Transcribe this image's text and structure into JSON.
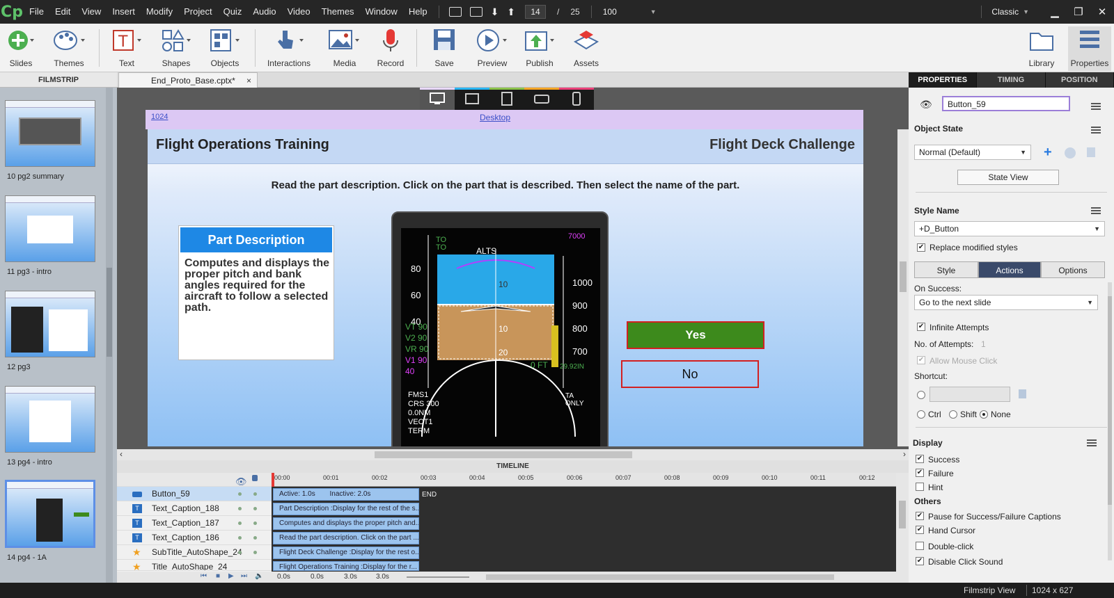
{
  "menubar": {
    "logo": "Cp",
    "menus": [
      "File",
      "Edit",
      "View",
      "Insert",
      "Modify",
      "Project",
      "Quiz",
      "Audio",
      "Video",
      "Themes",
      "Window",
      "Help"
    ],
    "slide_current": "14",
    "slide_separator": "/",
    "slide_total": "25",
    "zoom": "100",
    "workspace": "Classic"
  },
  "toolbar": {
    "items": [
      "Slides",
      "Themes",
      "Text",
      "Shapes",
      "Objects",
      "Interactions",
      "Media",
      "Record",
      "Save",
      "Preview",
      "Publish",
      "Assets",
      "Library",
      "Properties"
    ]
  },
  "filmstrip": {
    "header": "FILMSTRIP",
    "items": [
      "10 pg2 summary",
      "11 pg3 - intro",
      "12 pg3",
      "13 pg4 - intro",
      "14 pg4 - 1A"
    ]
  },
  "document": {
    "tab_name": "End_Proto_Base.cptx*",
    "close": "×"
  },
  "stage": {
    "ruler_left": "1024",
    "ruler_center": "Desktop",
    "device_colors": [
      "#ffffff",
      "#29b6f6",
      "#8bc34a",
      "#ffa726",
      "#ec407a"
    ]
  },
  "slide": {
    "title": "Flight Operations Training",
    "subtitle": "Flight Deck Challenge",
    "instruction": "Read the part description. Click on the part that is described. Then select the name of the part.",
    "part_heading": "Part Description",
    "part_body": "Computes and displays the proper pitch and bank angles required for the aircraft to follow a selected path.",
    "yes": "Yes",
    "no": "No",
    "pfd": {
      "alts": "ALTS",
      "speeds": [
        "80",
        "60",
        "40"
      ],
      "vspeeds": [
        "VT 90",
        "V2 90",
        "VR 90",
        "V1 90",
        "40"
      ],
      "alt_values": [
        "1000",
        "900",
        "800",
        "700"
      ],
      "alt_top": "7000",
      "zero_ft": "0 FT",
      "baro": "29.92IN",
      "fms": [
        "FMS1",
        "CRS 300",
        "0.0NM",
        "VECT1",
        "TERM"
      ],
      "pitch": [
        "10",
        "10",
        "20"
      ],
      "to": [
        "TO",
        "TO"
      ],
      "ta_only": [
        "TA",
        "ONLY"
      ]
    }
  },
  "timeline": {
    "header": "TIMELINE",
    "ticks": [
      "00:00",
      "00:01",
      "00:02",
      "00:03",
      "00:04",
      "00:05",
      "00:06",
      "00:07",
      "00:08",
      "00:09",
      "00:10",
      "00:11",
      "00:12"
    ],
    "rows": [
      {
        "name": "Button_59",
        "bar_a": "Active: 1.0s",
        "bar_b": "Inactive: 2.0s"
      },
      {
        "name": "Text_Caption_188",
        "bar": "Part Description :Display for the rest of the s..."
      },
      {
        "name": "Text_Caption_187",
        "bar": "Computes and displays the proper pitch and..."
      },
      {
        "name": "Text_Caption_186",
        "bar": "Read the part description. Click on the part ..."
      },
      {
        "name": "SubTitle_AutoShape_24",
        "bar": "Flight Deck Challenge :Display for the rest o..."
      },
      {
        "name": "Title_AutoShape_24",
        "bar": "Flight Operations Training :Display for the r..."
      }
    ],
    "end_label": "END",
    "bottom": [
      "0.0s",
      "0.0s",
      "3.0s",
      "3.0s"
    ]
  },
  "properties": {
    "tabs": [
      "PROPERTIES",
      "TIMING",
      "POSITION"
    ],
    "object_name": "Button_59",
    "object_state_label": "Object State",
    "state_value": "Normal (Default)",
    "state_view": "State View",
    "style_name_label": "Style Name",
    "style_value": "+D_Button",
    "replace_styles": "Replace modified styles",
    "segments": [
      "Style",
      "Actions",
      "Options"
    ],
    "on_success_label": "On Success:",
    "on_success_value": "Go to the next slide",
    "infinite": "Infinite Attempts",
    "attempts_label": "No. of Attempts:",
    "attempts_value": "1",
    "allow_mouse": "Allow Mouse Click",
    "shortcut_label": "Shortcut:",
    "mod_keys": [
      "Ctrl",
      "Shift",
      "None"
    ],
    "display_label": "Display",
    "display_items": [
      "Success",
      "Failure",
      "Hint"
    ],
    "others_label": "Others",
    "others_items": [
      "Pause for Success/Failure Captions",
      "Hand Cursor",
      "Double-click",
      "Disable Click Sound"
    ]
  },
  "status": {
    "view": "Filmstrip View",
    "size": "1024 x 627"
  }
}
